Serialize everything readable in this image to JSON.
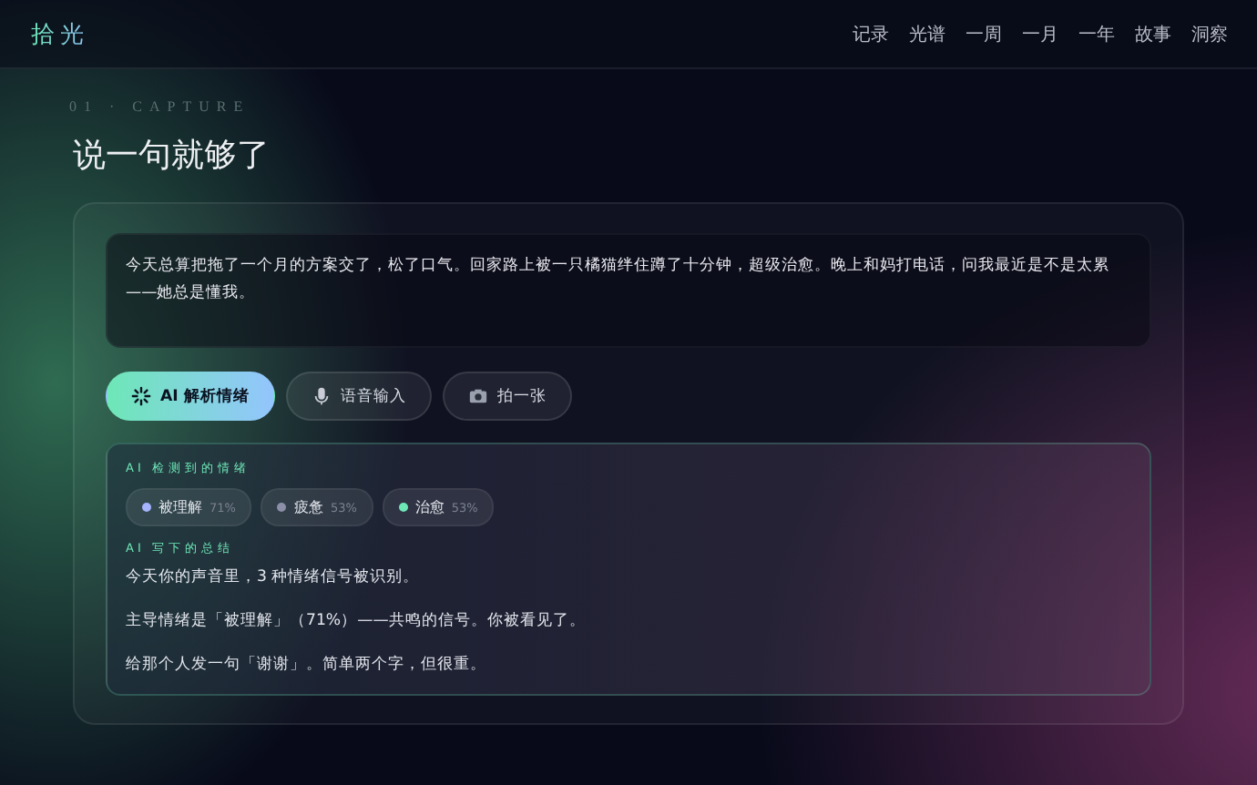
{
  "brand": "拾光",
  "nav": [
    "记录",
    "光谱",
    "一周",
    "一月",
    "一年",
    "故事",
    "洞察"
  ],
  "section_label": "01 · CAPTURE",
  "title": "说一句就够了",
  "entry": {
    "value": "今天总算把拖了一个月的方案交了，松了口气。回家路上被一只橘猫绊住蹲了十分钟，超级治愈。晚上和妈打电话，问我最近是不是太累——她总是懂我。"
  },
  "actions": [
    {
      "kind": "analyze",
      "label": "AI 解析情绪"
    },
    {
      "kind": "voice",
      "label": "语音输入"
    },
    {
      "kind": "photo",
      "label": "拍一张"
    }
  ],
  "result": {
    "emotions_heading": "AI 检测到的情绪",
    "emotions": [
      {
        "name": "被理解",
        "percent": "71%",
        "color": "#a5b4fc"
      },
      {
        "name": "疲惫",
        "percent": "53%",
        "color": "#8b8fa8"
      },
      {
        "name": "治愈",
        "percent": "53%",
        "color": "#6ee7b7"
      }
    ],
    "summary_heading": "AI 写下的总结",
    "summary": [
      "今天你的声音里，3 种情绪信号被识别。",
      "主导情绪是「被理解」（71%）——共鸣的信号。你被看见了。",
      "给那个人发一句「谢谢」。简单两个字，但很重。"
    ]
  }
}
